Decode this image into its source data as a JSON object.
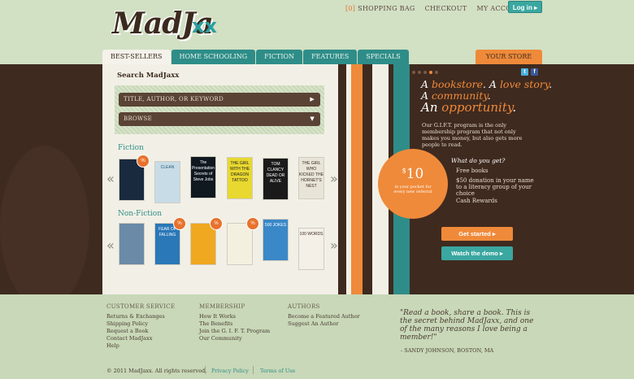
{
  "brand": {
    "logo_text": "MadJa",
    "logo_mark": "xx"
  },
  "topnav": {
    "bag_count": "[0]",
    "bag_label": "SHOPPING BAG",
    "checkout": "CHECKOUT",
    "account": "MY ACCOUNT",
    "login": "Log in ▸"
  },
  "tabs": [
    "BEST-SELLERS",
    "HOME SCHOOLING",
    "FICTION",
    "FEATURES",
    "SPECIALS"
  ],
  "your_store": "YOUR STORE",
  "search": {
    "title": "Search MadJaxx",
    "field_placeholder": "TITLE, AUTHOR, OR KEYWORD",
    "browse": "BROWSE"
  },
  "sections": {
    "fiction": "Fiction",
    "nonfiction": "Non-Fiction"
  },
  "fiction_books": [
    {
      "title": "",
      "color": "#1a2a3e"
    },
    {
      "title": "CLEAN",
      "color": "#c8dce8"
    },
    {
      "title": "The Presentation Secrets of Steve Jobs",
      "color": "#101820"
    },
    {
      "title": "THE GIRL WITH THE DRAGON TATTOO",
      "color": "#e8d830"
    },
    {
      "title": "TOM CLANCY DEAD OR ALIVE",
      "color": "#1a1a1a"
    },
    {
      "title": "THE GIRL WHO KICKED THE HORNET'S NEST",
      "color": "#e8e4d8"
    }
  ],
  "nonfiction_books": [
    {
      "title": "",
      "color": "#6a8aa8"
    },
    {
      "title": "FEAR OF FALLING",
      "color": "#2a78b8"
    },
    {
      "title": "",
      "color": "#f0a820"
    },
    {
      "title": "",
      "color": "#f4f0e0"
    },
    {
      "title": "500 JOKES",
      "color": "#3a88c8"
    },
    {
      "title": "100 WORDS",
      "color": "#f4f0e8"
    }
  ],
  "badge_label": "%",
  "promo": {
    "line1_a": "A ",
    "line1_b": "bookstore",
    "line1_c": ". A ",
    "line1_d": "love story",
    "line2_a": "A ",
    "line2_b": "community",
    "line3_a": "An ",
    "line3_b": "opportunity",
    "text": "Our G.I.F.T. program is the only membership program that not only makes you money, but also gets more people to read.",
    "amount": "10",
    "currency": "$",
    "amount_sub": "in your pocket for every new referral",
    "what_title": "What do you get?",
    "perks": [
      "Free books",
      "$50 donation in your name to a literacy group of your choice",
      "Cash Rewards"
    ],
    "get_started": "Get started ▸",
    "watch_demo": "Watch the demo ▸"
  },
  "footer": {
    "customer_service": {
      "title": "CUSTOMER SERVICE",
      "links": [
        "Returns & Exchanges",
        "Shipping Policy",
        "Request a Book",
        "Contact MadJaxx",
        "Help"
      ]
    },
    "membership": {
      "title": "MEMBERSHIP",
      "links": [
        "How It Works",
        "The Benefits",
        "Join the G. I. F. T. Program",
        "Our Community"
      ]
    },
    "authors": {
      "title": "AUTHORS",
      "links": [
        "Become a Featured Author",
        "Suggest An Author"
      ]
    },
    "quote": "\"Read a book, share a book. This is the secret behind MadJaxx, and one of the many reasons I love being a member!\"",
    "quote_by": "- SANDY JOHNSON, BOSTON, MA",
    "copyright": "© 2011 MadJaxx. All rights reserved.",
    "privacy": "Privacy Policy",
    "terms": "Terms of Use"
  },
  "colors": {
    "teal": "#2e8d88",
    "orange": "#ef8a3a",
    "dark_brown": "#3f2a1f",
    "sage": "#c8d8b8"
  }
}
